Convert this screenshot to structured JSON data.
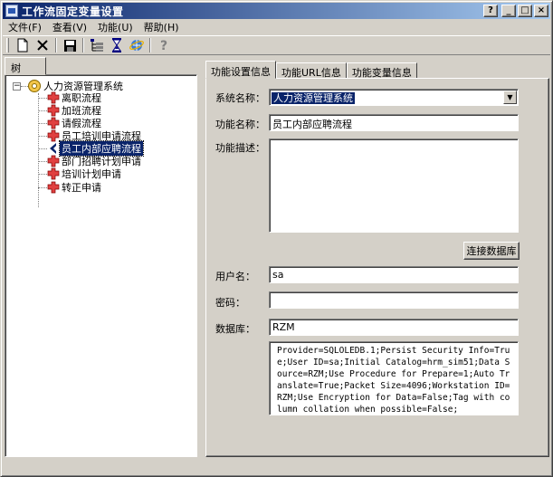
{
  "window": {
    "title": "工作流固定变量设置",
    "controls": {
      "help": "?",
      "minimize": "_",
      "maximize": "□",
      "close": "×"
    }
  },
  "menu": [
    {
      "label": "文件(F)"
    },
    {
      "label": "查看(V)"
    },
    {
      "label": "功能(U)"
    },
    {
      "label": "帮助(H)"
    }
  ],
  "toolbar": {
    "icons": [
      "new-document-icon",
      "delete-icon",
      "save-icon",
      "tree-view-icon",
      "hourglass-icon",
      "internet-explorer-icon",
      "help-icon"
    ]
  },
  "tree": {
    "tab_label": "树",
    "root": {
      "label": "人力资源管理系统",
      "expander": "−"
    },
    "children": [
      {
        "label": "离职流程"
      },
      {
        "label": "加班流程"
      },
      {
        "label": "请假流程"
      },
      {
        "label": "员工培训申请流程"
      },
      {
        "label": "员工内部应聘流程",
        "selected": true
      },
      {
        "label": "部门招聘计划申请"
      },
      {
        "label": "培训计划申请"
      },
      {
        "label": "转正申请"
      }
    ]
  },
  "tabs": [
    {
      "label": "功能设置信息",
      "active": true
    },
    {
      "label": "功能URL信息"
    },
    {
      "label": "功能变量信息"
    }
  ],
  "form": {
    "system_name_label": "系统名称：",
    "system_name_value": "人力资源管理系统",
    "function_name_label": "功能名称：",
    "function_name_value": "员工内部应聘流程",
    "function_desc_label": "功能描述：",
    "function_desc_value": "",
    "connect_button": "连接数据库",
    "username_label": "用户名：",
    "username_value": "sa",
    "password_label": "密码：",
    "password_value": "",
    "database_label": "数据库：",
    "database_value": "RZM",
    "connection_string": "Provider=SQLOLEDB.1;Persist Security Info=True;User ID=sa;Initial Catalog=hrm_sim51;Data Source=RZM;Use Procedure for Prepare=1;Auto Translate=True;Packet Size=4096;Workstation ID=RZM;Use Encryption for Data=False;Tag with column collation when possible=False;"
  }
}
